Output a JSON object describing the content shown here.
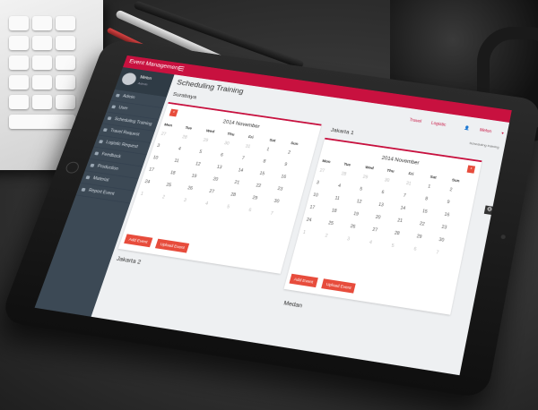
{
  "app": {
    "brand": "Event Management",
    "menu_icon": "hamburger-icon"
  },
  "user": {
    "name": "Melon",
    "role": "Admin"
  },
  "sidebar": {
    "items": [
      {
        "label": "Admin"
      },
      {
        "label": "User"
      },
      {
        "label": "Scheduling Training"
      },
      {
        "label": "Travel Request"
      },
      {
        "label": "Logistic Request"
      },
      {
        "label": "Feedback"
      },
      {
        "label": "Production"
      },
      {
        "label": "Material"
      },
      {
        "label": "Report Event"
      }
    ]
  },
  "header": {
    "title": "Scheduling Training",
    "links": {
      "travel": "Travel",
      "logistic": "Logistic",
      "user": "Melon"
    },
    "breadcrumb": "Scheduling training"
  },
  "days_of_week": [
    "Mon",
    "Tue",
    "Wed",
    "Thu",
    "Fri",
    "Sat",
    "Sun"
  ],
  "calendars": [
    {
      "city": "Surabaya",
      "month": "2014 November",
      "weeks": [
        [
          "27",
          "28",
          "29",
          "30",
          "31",
          "1",
          "2"
        ],
        [
          "3",
          "4",
          "5",
          "6",
          "7",
          "8",
          "9"
        ],
        [
          "10",
          "11",
          "12",
          "13",
          "14",
          "15",
          "16"
        ],
        [
          "17",
          "18",
          "19",
          "20",
          "21",
          "22",
          "23"
        ],
        [
          "24",
          "25",
          "26",
          "27",
          "28",
          "29",
          "30"
        ],
        [
          "1",
          "2",
          "3",
          "4",
          "5",
          "6",
          "7"
        ]
      ],
      "add_label": "Add Event",
      "upload_label": "Upload Event"
    },
    {
      "city": "Jakarta 1",
      "month": "2014 November",
      "weeks": [
        [
          "27",
          "28",
          "29",
          "30",
          "31",
          "1",
          "2"
        ],
        [
          "3",
          "4",
          "5",
          "6",
          "7",
          "8",
          "9"
        ],
        [
          "10",
          "11",
          "12",
          "13",
          "14",
          "15",
          "16"
        ],
        [
          "17",
          "18",
          "19",
          "20",
          "21",
          "22",
          "23"
        ],
        [
          "24",
          "25",
          "26",
          "27",
          "28",
          "29",
          "30"
        ],
        [
          "1",
          "2",
          "3",
          "4",
          "5",
          "6",
          "7"
        ]
      ],
      "add_label": "Add Event",
      "upload_label": "Upload Event"
    }
  ],
  "more_sections": [
    "Jakarta 2",
    "Medan"
  ],
  "colors": {
    "accent": "#c8113f",
    "button": "#e74c3c",
    "sidebar": "#3c4955"
  }
}
